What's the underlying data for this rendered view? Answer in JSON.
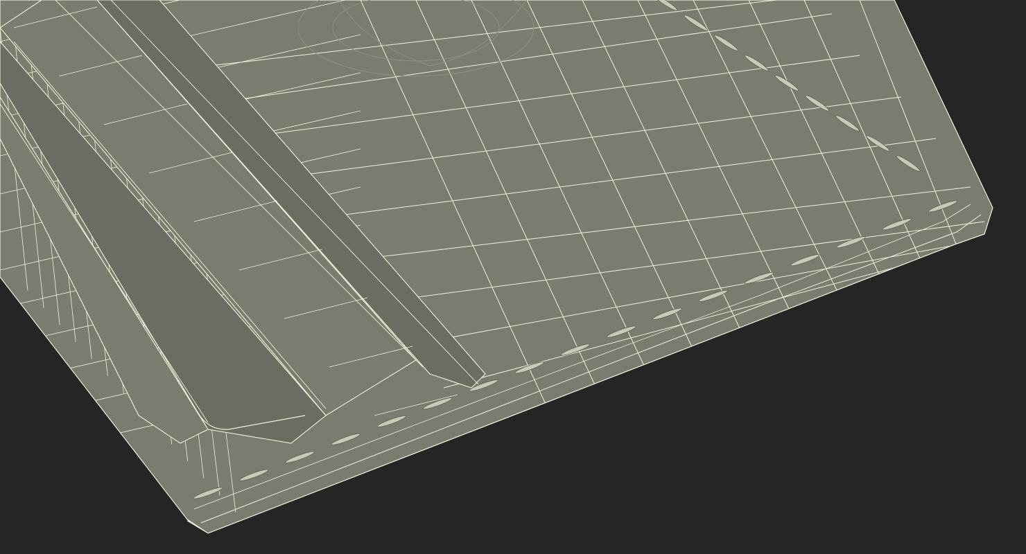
{
  "scene": {
    "subject": "wallet-3d-wireframe",
    "background_color": "#252525",
    "surface_color": "#7b7b70",
    "surface_dark_color": "#6c6c62",
    "edge_color": "#8a8a7e",
    "wire_color": "#f2f2dc",
    "stitch_color": "#c9c9b6"
  }
}
